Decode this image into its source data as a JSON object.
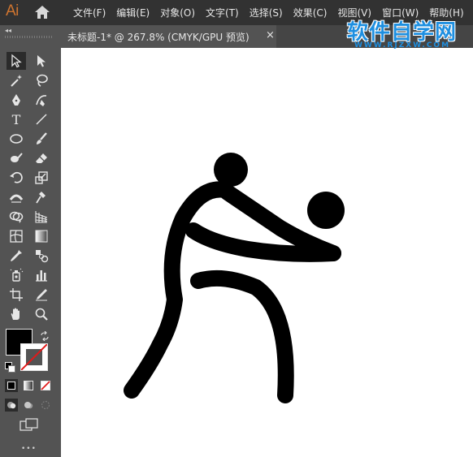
{
  "app": {
    "logo": "Ai"
  },
  "menu": [
    "文件(F)",
    "编辑(E)",
    "对象(O)",
    "文字(T)",
    "选择(S)",
    "效果(C)",
    "视图(V)",
    "窗口(W)",
    "帮助(H)"
  ],
  "document_tab": {
    "title": "未标题-1* @ 267.8% (CMYK/GPU 预览)",
    "close": "×"
  },
  "toolbar": {
    "collapse": "◂◂",
    "tools": [
      "selection-tool",
      "direct-selection-tool",
      "magic-wand-tool",
      "lasso-tool",
      "pen-tool",
      "curvature-tool",
      "type-tool",
      "line-segment-tool",
      "ellipse-tool",
      "paintbrush-tool",
      "shaper-tool",
      "eraser-tool",
      "rotate-tool",
      "scale-tool",
      "width-tool",
      "puppet-warp-tool",
      "shape-builder-tool",
      "perspective-grid-tool",
      "mesh-tool",
      "gradient-tool",
      "eyedropper-tool",
      "blend-tool",
      "symbol-sprayer-tool",
      "column-graph-tool",
      "artboard-tool",
      "slice-tool",
      "hand-tool",
      "zoom-tool"
    ],
    "more": "•••"
  },
  "colors": {
    "fill": "#000000",
    "stroke": "none",
    "menubar": "#323232",
    "panel": "#535353",
    "canvas": "#ffffff"
  },
  "watermark": {
    "text": "软件自学网",
    "url": "WWW.RJZXW.COM"
  }
}
